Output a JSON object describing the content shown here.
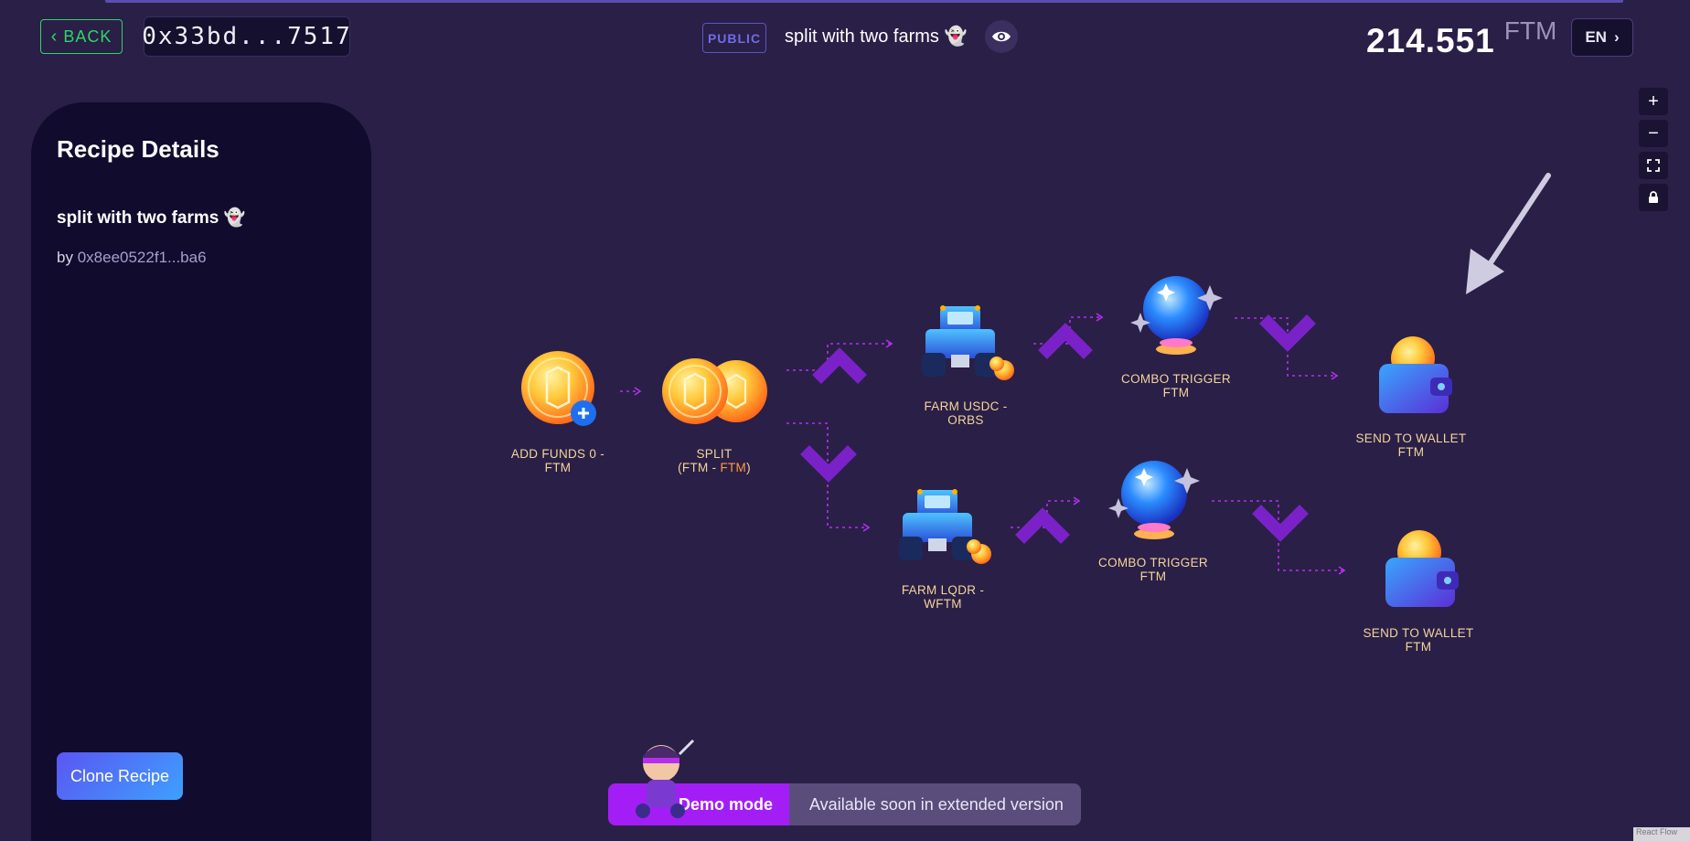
{
  "header": {
    "back_label": "BACK",
    "wallet_address": "0x33bd...7517",
    "visibility_badge": "PUBLIC",
    "recipe_title": "split with two farms 👻",
    "balance_amount": "214.551",
    "balance_unit": "FTM",
    "language": "EN"
  },
  "sidebar": {
    "heading": "Recipe Details",
    "recipe_name": "split with two farms 👻",
    "by_prefix": "by",
    "author": "0x8ee0522f1...ba6",
    "clone_label": "Clone Recipe"
  },
  "zoom_controls": [
    "zoom-in",
    "zoom-out",
    "fit-view",
    "lock"
  ],
  "nodes": {
    "add_funds": "ADD FUNDS 0 -\nFTM",
    "split_line1": "SPLIT",
    "split_paren_open": "(FTM - ",
    "split_accent": "FTM",
    "split_paren_close": ")",
    "farm_usdc": "FARM USDC -\nORBS",
    "combo_top": "COMBO TRIGGER\nFTM",
    "send_top": "SEND TO WALLET\nFTM",
    "farm_lqdr": "FARM LQDR -\nWFTM",
    "combo_bottom": "COMBO TRIGGER\nFTM",
    "send_bottom": "SEND TO WALLET\nFTM"
  },
  "demo": {
    "mode_label": "Demo mode",
    "message": "Available soon in extended version"
  },
  "attribution": "React Flow",
  "colors": {
    "background": "#2a1f47",
    "sidebar": "#110b2d",
    "accent_purple": "#a21ef5",
    "back_green": "#2fd36b",
    "label_gold": "#f3d59a"
  }
}
